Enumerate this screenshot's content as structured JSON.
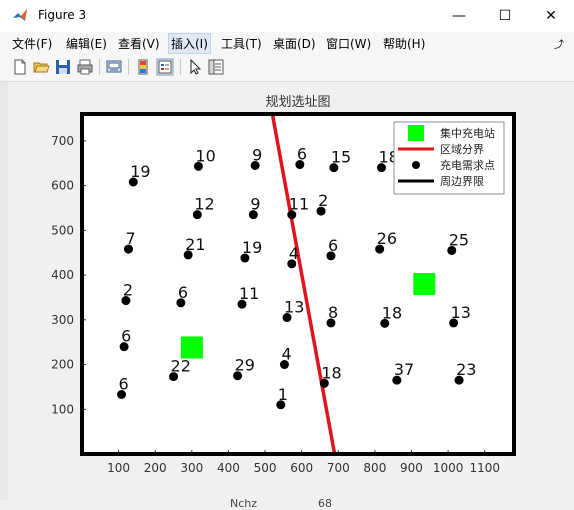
{
  "window": {
    "title": "Figure 3"
  },
  "menus": [
    "文件(F)",
    "编辑(E)",
    "查看(V)",
    "插入(I)",
    "工具(T)",
    "桌面(D)",
    "窗口(W)",
    "帮助(H)"
  ],
  "active_menu_index": 3,
  "toolbar_icons": [
    "new-figure-icon",
    "open-icon",
    "save-icon",
    "print-icon",
    "link-icon",
    "colorbar-icon",
    "legend-icon",
    "pointer-icon",
    "property-editor-icon"
  ],
  "chart_data": {
    "type": "scatter",
    "title": "规划选址图",
    "xlim": [
      0,
      1180
    ],
    "ylim": [
      0,
      760
    ],
    "xticks": [
      100,
      200,
      300,
      400,
      500,
      600,
      700,
      800,
      900,
      1000,
      1100
    ],
    "yticks": [
      100,
      200,
      300,
      400,
      500,
      600,
      700
    ],
    "demand_points": [
      {
        "x": 140,
        "y": 608,
        "label": "19"
      },
      {
        "x": 318,
        "y": 643,
        "label": "10"
      },
      {
        "x": 473,
        "y": 645,
        "label": "9"
      },
      {
        "x": 595,
        "y": 647,
        "label": "6"
      },
      {
        "x": 688,
        "y": 640,
        "label": "15"
      },
      {
        "x": 818,
        "y": 640,
        "label": "18"
      },
      {
        "x": 315,
        "y": 535,
        "label": "12"
      },
      {
        "x": 468,
        "y": 535,
        "label": "9"
      },
      {
        "x": 573,
        "y": 535,
        "label": "11"
      },
      {
        "x": 653,
        "y": 543,
        "label": "2"
      },
      {
        "x": 127,
        "y": 458,
        "label": "7"
      },
      {
        "x": 290,
        "y": 445,
        "label": "21"
      },
      {
        "x": 445,
        "y": 438,
        "label": "19"
      },
      {
        "x": 573,
        "y": 425,
        "label": "4"
      },
      {
        "x": 680,
        "y": 443,
        "label": "6"
      },
      {
        "x": 813,
        "y": 458,
        "label": "26"
      },
      {
        "x": 1010,
        "y": 455,
        "label": "25"
      },
      {
        "x": 120,
        "y": 343,
        "label": "2"
      },
      {
        "x": 270,
        "y": 338,
        "label": "6"
      },
      {
        "x": 437,
        "y": 335,
        "label": "11"
      },
      {
        "x": 560,
        "y": 305,
        "label": "13"
      },
      {
        "x": 680,
        "y": 293,
        "label": "8"
      },
      {
        "x": 827,
        "y": 292,
        "label": "18"
      },
      {
        "x": 1015,
        "y": 293,
        "label": "13"
      },
      {
        "x": 115,
        "y": 240,
        "label": "6"
      },
      {
        "x": 250,
        "y": 173,
        "label": "22"
      },
      {
        "x": 425,
        "y": 175,
        "label": "29"
      },
      {
        "x": 553,
        "y": 200,
        "label": "4"
      },
      {
        "x": 662,
        "y": 158,
        "label": "18"
      },
      {
        "x": 860,
        "y": 165,
        "label": "37"
      },
      {
        "x": 1030,
        "y": 165,
        "label": "23"
      },
      {
        "x": 108,
        "y": 133,
        "label": "6"
      },
      {
        "x": 543,
        "y": 110,
        "label": "1"
      }
    ],
    "charging_stations": [
      {
        "x": 300,
        "y": 238
      },
      {
        "x": 935,
        "y": 380
      }
    ],
    "boundary_line": {
      "from": {
        "x": 520,
        "y": 760
      },
      "to": {
        "x": 690,
        "y": 0
      }
    },
    "legend": {
      "placement": "top-right",
      "entries": [
        "集中充电站",
        "区域分界",
        "充电需求点",
        "周边界限"
      ]
    },
    "colors": {
      "station": "#00ff00",
      "boundary": "#e0141b",
      "points": "#000000",
      "frame": "#000000"
    }
  },
  "background_leak": {
    "text1": "Nchz",
    "text2": "68"
  }
}
